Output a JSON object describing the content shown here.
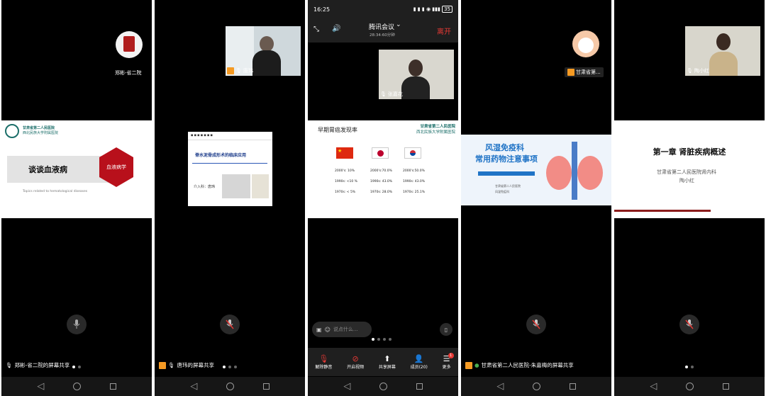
{
  "panel1": {
    "avatar_name": "郑彬-省二院",
    "slide_org": "甘肃省第二人民医院",
    "slide_org_sub": "西北民族大学附属医院",
    "slide_title": "谈谈血液病",
    "slide_subtitle": "Topics related to hematological diseases",
    "slide_badge": "血液病学",
    "bottom_label": "郑彬-省二院的屏幕共享"
  },
  "panel2": {
    "cam_name": "唐玮",
    "slide_title": "脊水泥骨成形术的临床应用",
    "slide_presenter": "介入科：唐玮",
    "bottom_label": "唐玮的屏幕共享"
  },
  "panel3": {
    "status_time": "16:25",
    "status_battery": "35",
    "meeting_title": "腾讯会议",
    "meeting_duration": "28:34:60分钟",
    "leave_label": "离开",
    "cam_name": "张嘉花",
    "slide_heading": "早期胃癌发现率",
    "slide_org": "甘肃省第二人民医院",
    "slide_org_sub": "西北民族大学附属医院",
    "china_stats": [
      "2000's: 10%",
      "1990s: <10 %",
      "1970s: < 5%"
    ],
    "japan_stats": [
      "2000's:70.0%",
      "1990s: 43.0%",
      "1970s: 28.0%"
    ],
    "korea_stats": [
      "2000's:50.0%",
      "1990s: 43.0%",
      "1970s: 25.1%"
    ],
    "comment_placeholder": "说点什么...",
    "toolbar": [
      {
        "label": "解除静音",
        "icon": "mic-icon"
      },
      {
        "label": "开启视频",
        "icon": "video-off-icon"
      },
      {
        "label": "共享屏幕",
        "icon": "share-screen-icon"
      },
      {
        "label": "成员(20)",
        "icon": "members-icon"
      },
      {
        "label": "更多",
        "icon": "more-icon"
      }
    ],
    "more_badge": "1"
  },
  "panel4": {
    "avatar_name": "甘肃省第...",
    "slide_title_line1": "风湿免疫科",
    "slide_title_line2": "常用药物注意事项",
    "slide_org": "甘肃省第二人民医院",
    "slide_dept": "风湿免疫科",
    "bottom_label": "甘肃省第二人民医院-朱嘉梅的屏幕共享"
  },
  "panel5": {
    "cam_name": "陶小红",
    "slide_title": "第一章   肾脏疾病概述",
    "slide_org": "甘肃省第二人民医院肾内科",
    "slide_presenter": "陶小红"
  }
}
